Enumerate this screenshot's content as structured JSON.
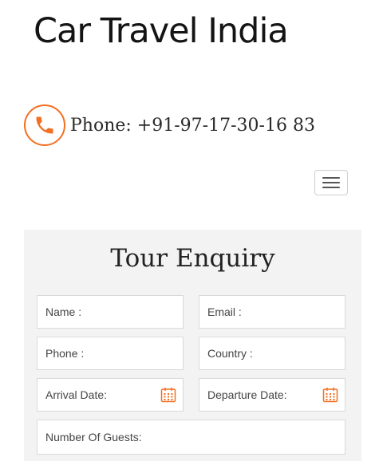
{
  "header": {
    "site_title": "Car Travel India",
    "phone_text": "Phone: +91-97-17-30-16 83"
  },
  "enquiry": {
    "title": "Tour Enquiry",
    "fields": {
      "name": "Name :",
      "email": "Email :",
      "phone": "Phone :",
      "country": "Country :",
      "arrival": "Arrival Date:",
      "departure": "Departure Date:",
      "guests": "Number Of Guests:"
    }
  },
  "colors": {
    "accent": "#f36f21",
    "panel_bg": "#f3f3f3"
  },
  "icons": {
    "phone": "phone-icon",
    "calendar": "calendar-icon",
    "menu": "hamburger-menu-icon"
  }
}
